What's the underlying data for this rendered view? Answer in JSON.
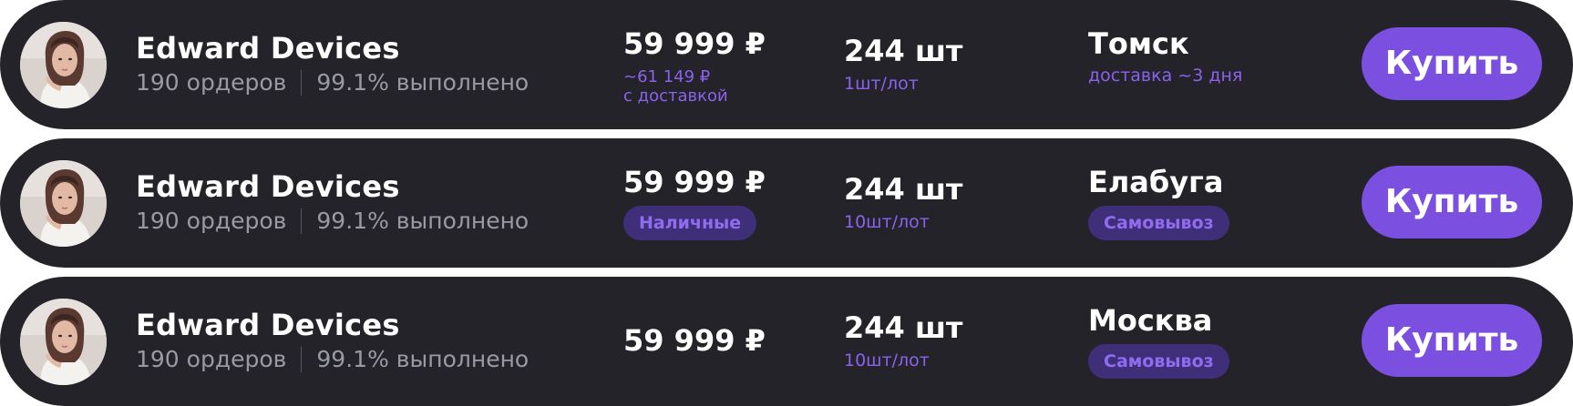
{
  "offers": [
    {
      "seller": {
        "name": "Edward Devices",
        "orders": "190 ордеров",
        "fulfilled": "99.1% выполнено"
      },
      "price": "59 999 ₽",
      "price_note_line1": "~61 149 ₽",
      "price_note_line2": "с доставкой",
      "quantity": "244 шт",
      "lot": "1шт/лот",
      "city": "Томск",
      "delivery_note": "доставка ~3 дня",
      "buy_label": "Купить"
    },
    {
      "seller": {
        "name": "Edward Devices",
        "orders": "190 ордеров",
        "fulfilled": "99.1% выполнено"
      },
      "price": "59 999 ₽",
      "payment_badge": "Наличные",
      "quantity": "244 шт",
      "lot": "10шт/лот",
      "city": "Елабуга",
      "pickup_badge": "Самовывоз",
      "buy_label": "Купить"
    },
    {
      "seller": {
        "name": "Edward Devices",
        "orders": "190 ордеров",
        "fulfilled": "99.1% выполнено"
      },
      "price": "59 999 ₽",
      "quantity": "244 шт",
      "lot": "10шт/лот",
      "city": "Москва",
      "pickup_badge": "Самовывоз",
      "buy_label": "Купить"
    }
  ],
  "icons": {
    "avatar": "seller-avatar-photo"
  },
  "colors": {
    "card_background": "#232329",
    "accent": "#7b4fe0",
    "accent_text": "#8b62ee",
    "badge_background": "#3f2f78",
    "muted_text": "#9a9aa3"
  }
}
